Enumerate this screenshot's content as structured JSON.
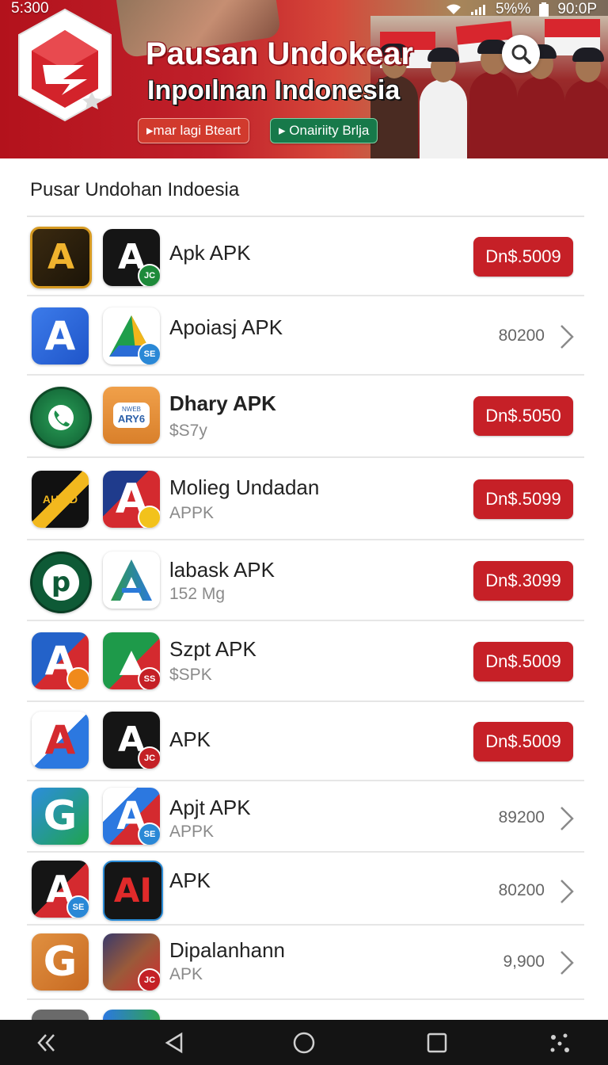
{
  "status_bar": {
    "time": "5:300",
    "battery": "5%%",
    "clock_right": "90:0P"
  },
  "banner": {
    "title": "Pausan Undokear",
    "subtitle": "Inpoılnan Indonesia",
    "pill_left": "mar lagi Bteart",
    "pill_right": "Onairiity Brlja"
  },
  "section": {
    "title": "Pusar Undohan Indoesia"
  },
  "apps": [
    {
      "name": "Apk APK",
      "sub": "",
      "action": "button",
      "price": "Dn$.5009"
    },
    {
      "name": "Apoiasj APK",
      "sub": "",
      "action": "text",
      "price": "80200"
    },
    {
      "name": "Dhary APK",
      "sub": "$S7y",
      "action": "button",
      "price": "Dn$.5050"
    },
    {
      "name": "Molieg Undadan",
      "sub": "APPK",
      "action": "button",
      "price": "Dn$.5099"
    },
    {
      "name": "labask APK",
      "sub": "152 Mg",
      "action": "button",
      "price": "Dn$.3099"
    },
    {
      "name": "Szpt APK",
      "sub": "$SPK",
      "action": "button",
      "price": "Dn$.5009"
    },
    {
      "name": "APK",
      "sub": "",
      "action": "button",
      "price": "Dn$.5009"
    },
    {
      "name": "Apjt APK",
      "sub": "APPK",
      "action": "text",
      "price": "89200"
    },
    {
      "name": "APK",
      "sub": "",
      "action": "text",
      "price": "80200"
    },
    {
      "name": "Dipalanhann",
      "sub": "APK",
      "action": "text",
      "price": "9,900"
    }
  ],
  "icons": {
    "search": "search-icon",
    "back": "back-double-chevron-icon",
    "nav": [
      "back-triangle-icon",
      "home-circle-icon",
      "recents-square-icon",
      "assistant-dots-icon"
    ]
  },
  "colors": {
    "accent": "#c62027",
    "banner_red": "#b3121c",
    "nav_bg": "#141414"
  }
}
